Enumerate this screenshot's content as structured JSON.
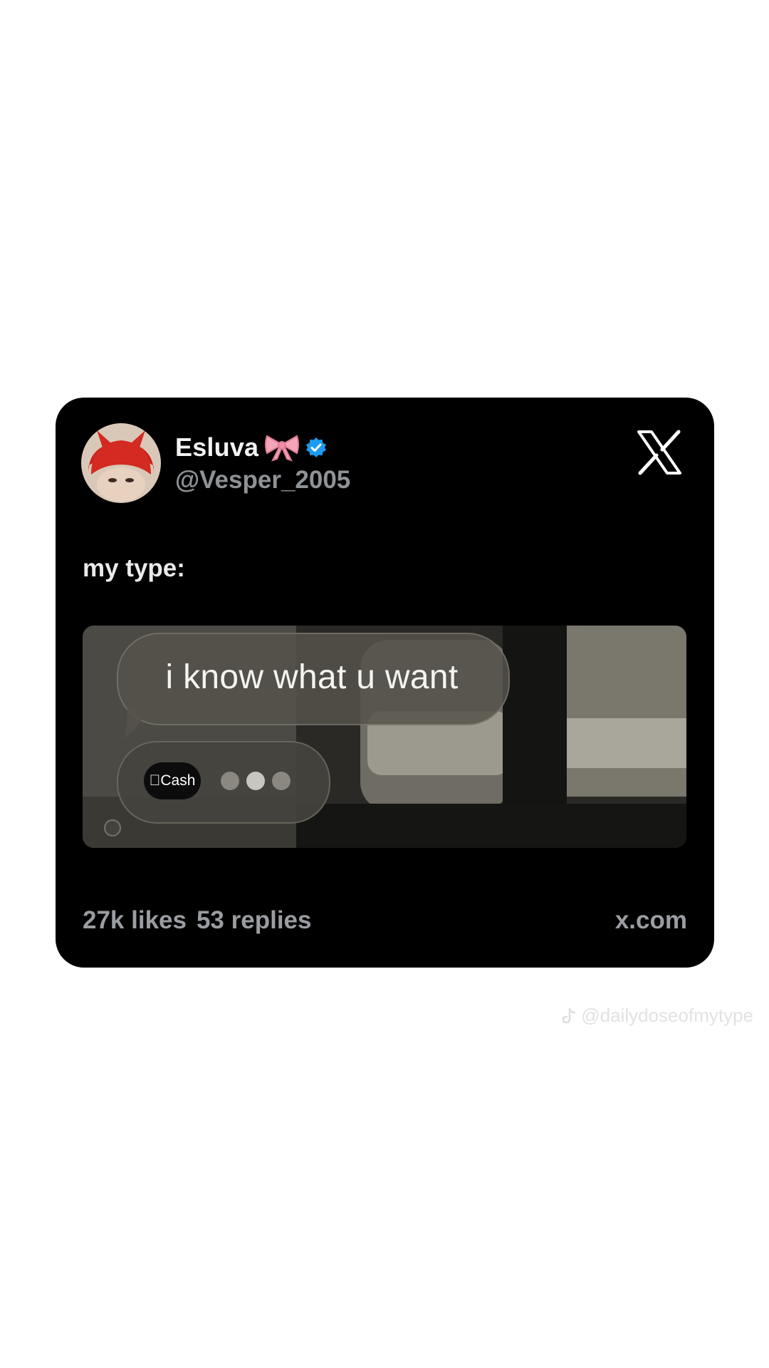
{
  "tweet": {
    "author": {
      "display_name": "Esluva",
      "handle": "@Vesper_2005",
      "emoji_icon": "bow-icon",
      "verified_icon": "verified-badge-icon"
    },
    "platform_logo": "x-logo",
    "text": "my type:",
    "media": {
      "message_text": "i know what u want",
      "cash_label": "Cash",
      "cash_icon": "apple-icon",
      "typing_indicator": "typing-dots"
    },
    "footer": {
      "likes": "27k likes",
      "replies": "53 replies",
      "domain": "x.com"
    }
  },
  "watermark": {
    "icon": "tiktok-icon",
    "text": "@dailydoseofmytype"
  },
  "colors": {
    "card_background": "#000000",
    "page_background": "#ffffff",
    "verified_blue": "#1d9bf0",
    "muted_text": "#9a9da1"
  }
}
